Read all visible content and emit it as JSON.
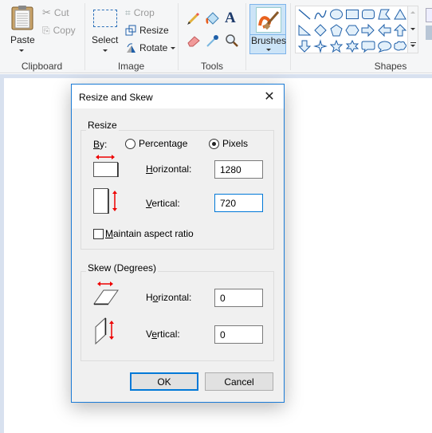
{
  "ribbon": {
    "clipboard": {
      "label": "Clipboard",
      "paste": "Paste",
      "cut": "Cut",
      "copy": "Copy"
    },
    "image": {
      "label": "Image",
      "select": "Select",
      "crop": "Crop",
      "resize": "Resize",
      "rotate": "Rotate"
    },
    "tools": {
      "label": "Tools",
      "items": [
        "pencil",
        "fill",
        "text",
        "eraser",
        "color-picker",
        "magnifier"
      ]
    },
    "brushes": {
      "label": "Brushes"
    },
    "shapes": {
      "label": "Shapes",
      "items": [
        "line",
        "curve",
        "oval",
        "rectangle",
        "rounded-rectangle",
        "polygon",
        "triangle",
        "right-triangle",
        "diamond",
        "pentagon",
        "hexagon",
        "right-arrow",
        "left-arrow",
        "up-arrow",
        "down-arrow",
        "four-point-star",
        "five-point-star",
        "six-point-star",
        "rounded-callout",
        "oval-callout",
        "cloud-callout"
      ]
    }
  },
  "dialog": {
    "title": "Resize and Skew",
    "resize": {
      "legend": "Resize",
      "by_label": "By:",
      "percentage": "Percentage",
      "pixels": "Pixels",
      "selected": "Pixels",
      "horizontal_label": "Horizontal:",
      "horizontal_value": "1280",
      "vertical_label": "Vertical:",
      "vertical_value": "720",
      "maintain_aspect": "Maintain aspect ratio",
      "maintain_aspect_checked": false
    },
    "skew": {
      "legend": "Skew (Degrees)",
      "horizontal_label": "Horizontal:",
      "horizontal_value": "0",
      "vertical_label": "Vertical:",
      "vertical_value": "0"
    },
    "ok": "OK",
    "cancel": "Cancel"
  }
}
